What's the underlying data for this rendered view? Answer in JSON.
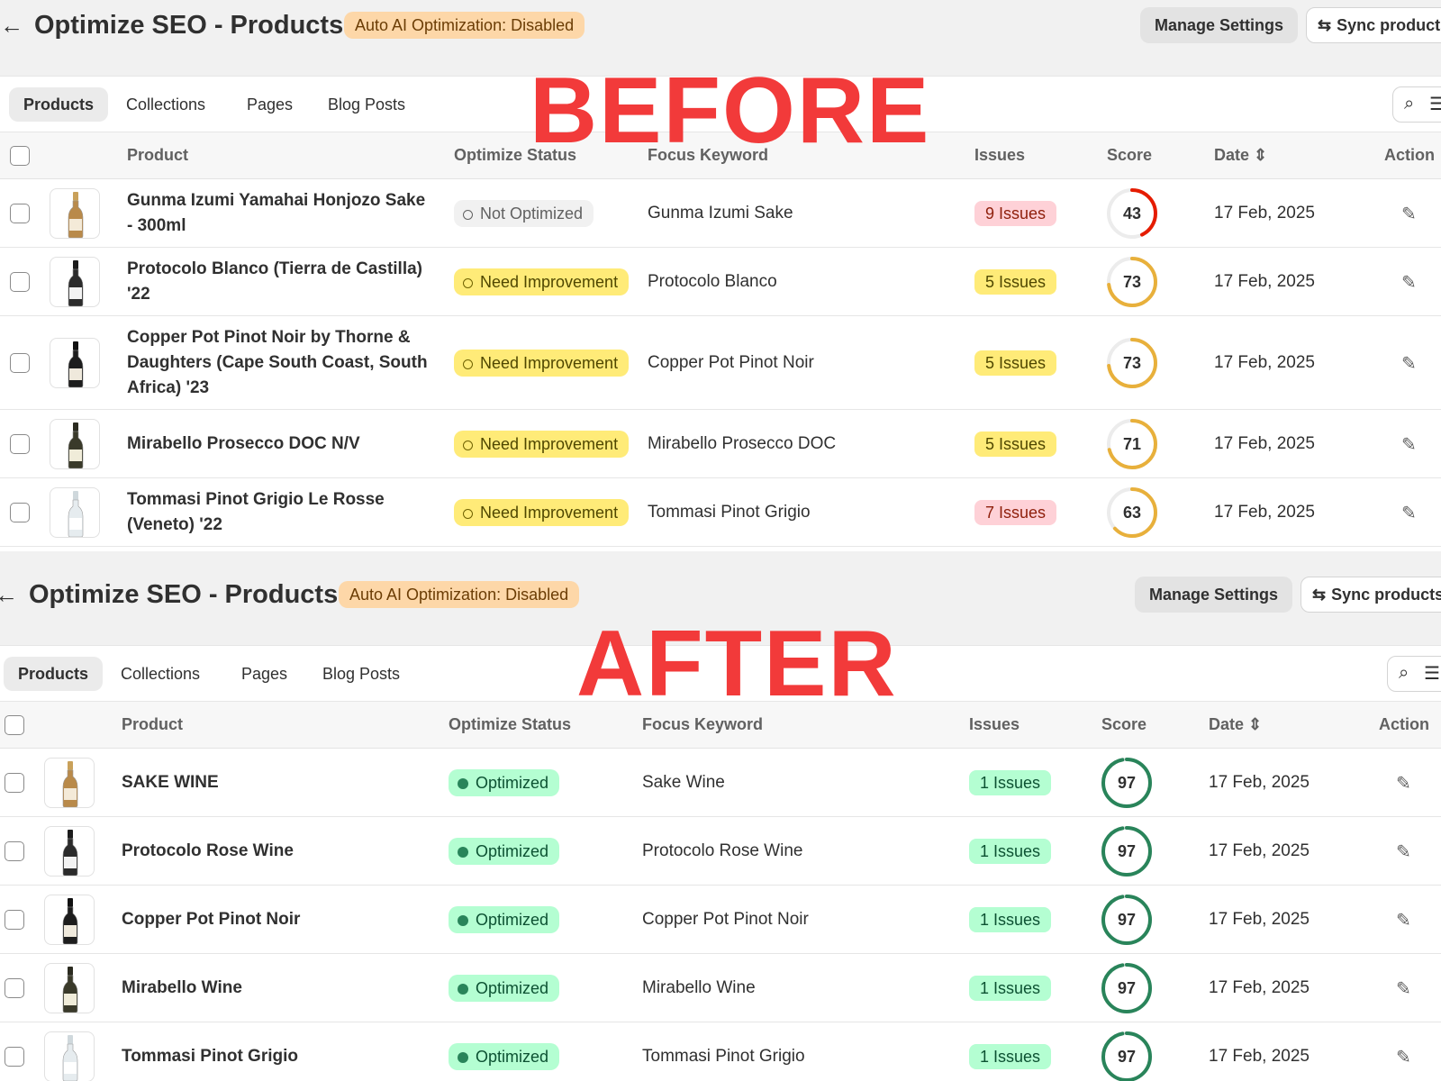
{
  "labels": {
    "before": "BEFORE",
    "after": "AFTER"
  },
  "header": {
    "back_icon": "←",
    "title": "Optimize SEO - Products",
    "auto_badge": "Auto AI Optimization: Disabled",
    "manage_label": "Manage Settings",
    "sync_label": "Sync products",
    "sync_icon": "⇆"
  },
  "tabs": [
    {
      "label": "Products",
      "active": true
    },
    {
      "label": "Collections",
      "active": false
    },
    {
      "label": "Pages",
      "active": false
    },
    {
      "label": "Blog Posts",
      "active": false
    }
  ],
  "toolbar": {
    "search_icon": "⌕",
    "filter_icon": "☰"
  },
  "columns": [
    "Product",
    "Optimize Status",
    "Focus Keyword",
    "Issues",
    "Score",
    "Date",
    "Action"
  ],
  "sort_icon": "⇕",
  "edit_icon": "✎",
  "colors": {
    "red_ring": "#e51c00",
    "yellow_ring": "#e8b03b",
    "green_ring": "#29845a",
    "track": "#ececec",
    "accent_red": "#f23a3a"
  },
  "before": {
    "rows": [
      {
        "name": "Gunma Izumi Yamahai Honjozo Sake - 300ml",
        "status": "Not Optimized",
        "keyword": "Gunma Izumi Sake",
        "issues": "9 Issues",
        "score": "43",
        "date": "17 Feb, 2025",
        "thumb": "sake"
      },
      {
        "name": "Protocolo Blanco (Tierra de Castilla) '22",
        "status": "Need Improvement",
        "keyword": "Protocolo Blanco",
        "issues": "5 Issues",
        "score": "73",
        "date": "17 Feb, 2025",
        "thumb": "white"
      },
      {
        "name": "Copper Pot Pinot Noir by Thorne & Daughters (Cape South Coast, South Africa) '23",
        "status": "Need Improvement",
        "keyword": "Copper Pot Pinot Noir",
        "issues": "5 Issues",
        "score": "73",
        "date": "17 Feb, 2025",
        "thumb": "red"
      },
      {
        "name": "Mirabello Prosecco DOC N/V",
        "status": "Need Improvement",
        "keyword": "Mirabello Prosecco DOC",
        "issues": "5 Issues",
        "score": "71",
        "date": "17 Feb, 2025",
        "thumb": "prosecco"
      },
      {
        "name": "Tommasi Pinot Grigio Le Rosse (Veneto) '22",
        "status": "Need Improvement",
        "keyword": "Tommasi Pinot Grigio",
        "issues": "7 Issues",
        "score": "63",
        "date": "17 Feb, 2025",
        "thumb": "clear"
      }
    ]
  },
  "after": {
    "rows": [
      {
        "name": "SAKE WINE",
        "status": "Optimized",
        "keyword": "Sake Wine",
        "issues": "1 Issues",
        "score": "97",
        "date": "17 Feb, 2025",
        "thumb": "sake"
      },
      {
        "name": "Protocolo Rose Wine",
        "status": "Optimized",
        "keyword": "Protocolo Rose Wine",
        "issues": "1 Issues",
        "score": "97",
        "date": "17 Feb, 2025",
        "thumb": "white"
      },
      {
        "name": "Copper Pot Pinot Noir",
        "status": "Optimized",
        "keyword": "Copper Pot Pinot Noir",
        "issues": "1 Issues",
        "score": "97",
        "date": "17 Feb, 2025",
        "thumb": "red"
      },
      {
        "name": "Mirabello Wine",
        "status": "Optimized",
        "keyword": "Mirabello Wine",
        "issues": "1 Issues",
        "score": "97",
        "date": "17 Feb, 2025",
        "thumb": "prosecco"
      },
      {
        "name": "Tommasi Pinot Grigio",
        "status": "Optimized",
        "keyword": "Tommasi Pinot Grigio",
        "issues": "1 Issues",
        "score": "97",
        "date": "17 Feb, 2025",
        "thumb": "clear"
      }
    ]
  }
}
